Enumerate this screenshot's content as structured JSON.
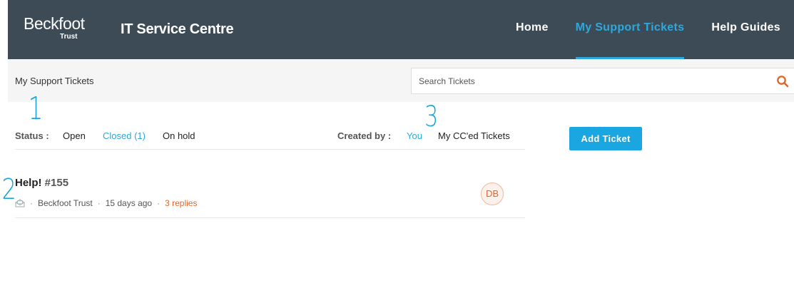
{
  "header": {
    "logo_main": "Beckfoot",
    "logo_sub": "Trust",
    "site_title": "IT Service Centre",
    "nav": [
      {
        "label": "Home",
        "active": false
      },
      {
        "label": "My Support Tickets",
        "active": true
      },
      {
        "label": "Help Guides",
        "active": false
      }
    ]
  },
  "subbar": {
    "breadcrumb": "My Support Tickets",
    "search": {
      "placeholder": "Search Tickets",
      "value": "",
      "icon": "search-icon"
    }
  },
  "annotations": [
    "1",
    "2",
    "3"
  ],
  "filters": {
    "status_label": "Status :",
    "status_options": [
      {
        "label": "Open",
        "selected": false
      },
      {
        "label": "Closed (1)",
        "selected": true
      },
      {
        "label": "On hold",
        "selected": false
      }
    ],
    "created_by_label": "Created by :",
    "created_by_options": [
      {
        "label": "You",
        "selected": true
      },
      {
        "label": "My CC'ed Tickets",
        "selected": false
      }
    ]
  },
  "actions": {
    "add_ticket": "Add Ticket"
  },
  "tickets": [
    {
      "title": "Help!",
      "id": "#155",
      "source_icon": "email-icon",
      "organisation": "Beckfoot Trust",
      "age": "15 days ago",
      "replies": "3 replies",
      "assignee_initials": "DB"
    }
  ],
  "colors": {
    "header_bg": "#3d4b56",
    "accent": "#2ea8dc",
    "button": "#1aa6e0",
    "replies": "#e0672a",
    "subbar_bg": "#f5f5f5"
  }
}
